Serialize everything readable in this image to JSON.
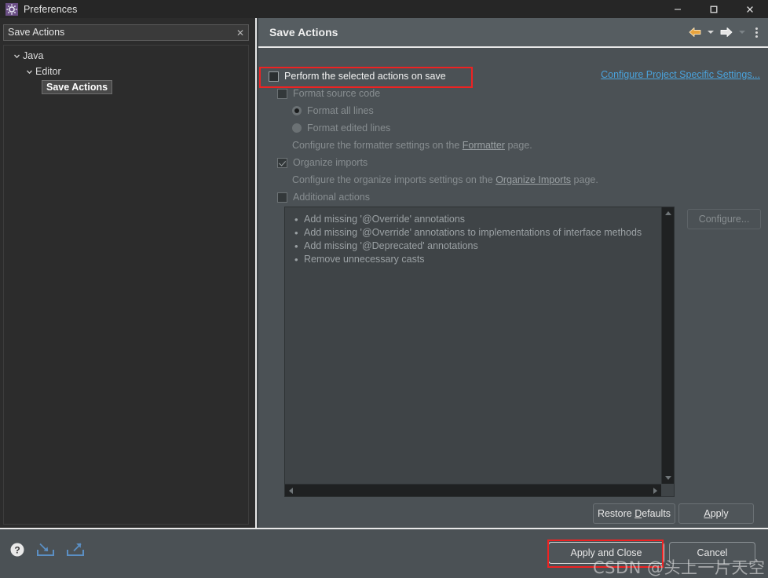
{
  "window": {
    "title": "Preferences",
    "icon": "preferences-gear-icon",
    "minimize_label": "—",
    "maximize_label": "☐",
    "close_label": "✕"
  },
  "sidebar": {
    "filter": {
      "value": "Save Actions",
      "placeholder": "type filter text",
      "clear_label": "✕"
    },
    "tree": [
      {
        "label": "Java",
        "depth": 0,
        "expanded": true,
        "selected": false
      },
      {
        "label": "Editor",
        "depth": 1,
        "expanded": true,
        "selected": false
      },
      {
        "label": "Save Actions",
        "depth": 2,
        "expanded": null,
        "selected": true
      }
    ]
  },
  "page": {
    "title": "Save Actions",
    "toolbar": {
      "back_icon": "back-arrow-icon",
      "back_menu_icon": "chevron-down-icon",
      "forward_icon": "forward-arrow-icon",
      "forward_menu_icon": "chevron-down-icon",
      "menu_icon": "kebab-menu-icon"
    },
    "project_settings_link": "Configure Project Specific Settings...",
    "options": {
      "perform_on_save": {
        "label": "Perform the selected actions on save",
        "checked": false,
        "enabled": true
      },
      "format_source": {
        "label": "Format source code",
        "checked": false,
        "enabled": false
      },
      "format_all_lines": {
        "label": "Format all lines",
        "selected": true,
        "enabled": false
      },
      "format_edited_lines": {
        "label": "Format edited lines",
        "selected": false,
        "enabled": false
      },
      "formatter_hint_before": "Configure the formatter settings on the",
      "formatter_link": "Formatter",
      "formatter_hint_after": "page.",
      "organize_imports": {
        "label": "Organize imports",
        "checked": true,
        "enabled": false
      },
      "organize_hint_before": "Configure the organize imports settings on the",
      "organize_link": "Organize Imports",
      "organize_hint_after": "page.",
      "additional_actions": {
        "label": "Additional actions",
        "checked": false,
        "enabled": false
      }
    },
    "actions_list": [
      "Add missing '@Override' annotations",
      "Add missing '@Override' annotations to implementations of interface methods",
      "Add missing '@Deprecated' annotations",
      "Remove unnecessary casts"
    ],
    "configure_button": "Configure...",
    "restore_defaults_button": "Restore Defaults",
    "apply_button": "Apply"
  },
  "footer": {
    "help_icon": "help-question-icon",
    "import_icon": "import-icon",
    "export_icon": "export-icon",
    "apply_and_close_button": "Apply and Close",
    "cancel_button": "Cancel"
  },
  "watermark": "CSDN @头上一片天空",
  "colors": {
    "accent_link": "#4aa3dd",
    "annotation": "#ee2222",
    "back_arrow": "#e8a33d",
    "window_bg": "#3c4245"
  }
}
